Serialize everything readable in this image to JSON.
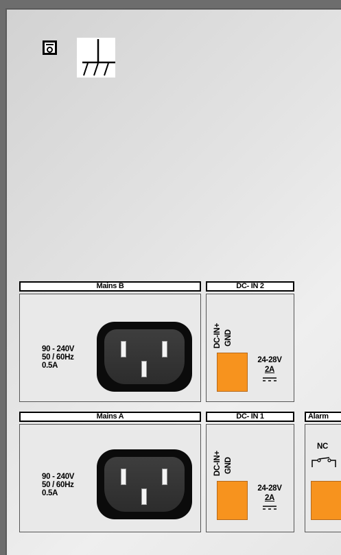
{
  "icons": {
    "fuse": "fuse-icon",
    "ground": "protective-earth-icon"
  },
  "mains_b": {
    "header": "Mains B",
    "specs": [
      "90 - 240V",
      "50 / 60Hz",
      "0.5A"
    ]
  },
  "dc_in2": {
    "header": "DC- IN 2",
    "pins": [
      "DC-IN+",
      "GND"
    ],
    "voltage": "24-28V",
    "current": "2A"
  },
  "mains_a": {
    "header": "Mains A",
    "specs": [
      "90 - 240V",
      "50 / 60Hz",
      "0.5A"
    ]
  },
  "dc_in1": {
    "header": "DC- IN 1",
    "pins": [
      "DC-IN+",
      "GND"
    ],
    "voltage": "24-28V",
    "current": "2A"
  },
  "alarm": {
    "header": "Alarm",
    "contact": "NC"
  },
  "colors": {
    "connector": "#f7931e",
    "socket": "#0b0b0b"
  }
}
